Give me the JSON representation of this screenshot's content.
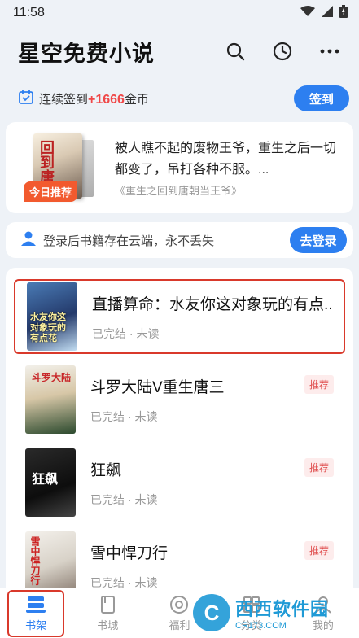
{
  "status_bar": {
    "time": "11:58"
  },
  "header": {
    "title": "星空免费小说"
  },
  "checkin": {
    "prefix": "连续签到",
    "highlight": "+1666",
    "suffix": "金币",
    "button": "签到"
  },
  "recommend": {
    "badge": "今日推荐",
    "cover_text": "回到唐朝",
    "description": "被人瞧不起的废物王爷，重生之后一切都变了，吊打各种不服。...",
    "source": "《重生之回到唐朝当王爷》"
  },
  "login": {
    "text": "登录后书籍存在云端，永不丢失",
    "button": "去登录"
  },
  "books": [
    {
      "title": "直播算命：水友你这对象玩的有点...",
      "meta": "已完结 · 未读",
      "tag": "",
      "cover_text": "水友你这对象玩的有点花"
    },
    {
      "title": "斗罗大陆V重生唐三",
      "meta": "已完结 · 未读",
      "tag": "推荐",
      "cover_text": "斗罗大陆"
    },
    {
      "title": "狂飙",
      "meta": "已完结 · 未读",
      "tag": "推荐",
      "cover_text": "狂飙"
    },
    {
      "title": "雪中悍刀行",
      "meta": "已完结 · 未读",
      "tag": "推荐",
      "cover_text": "雪中悍刀行"
    }
  ],
  "nav": [
    {
      "label": "书架",
      "icon": "bookshelf-icon"
    },
    {
      "label": "书城",
      "icon": "book-store-icon"
    },
    {
      "label": "福利",
      "icon": "welfare-icon"
    },
    {
      "label": "分类",
      "icon": "category-icon"
    },
    {
      "label": "我的",
      "icon": "profile-icon"
    }
  ],
  "watermark": {
    "main": "西西软件园",
    "sub": "CR173.COM"
  },
  "colors": {
    "accent": "#2d7ff0",
    "highlight": "#f04848",
    "selection": "#d9392b"
  }
}
